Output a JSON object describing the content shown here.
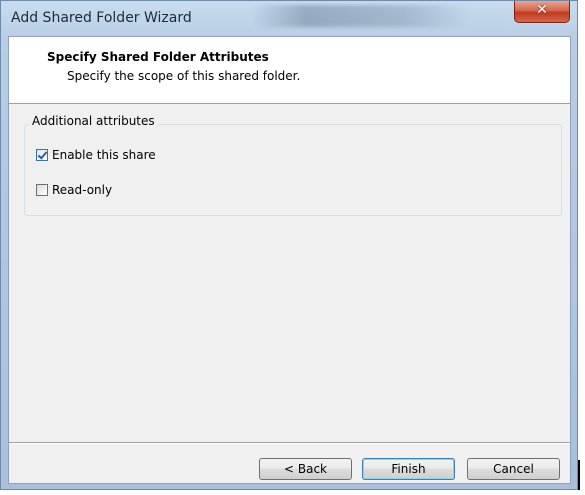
{
  "window": {
    "title": "Add Shared Folder Wizard",
    "close_glyph": "✕"
  },
  "header": {
    "title": "Specify Shared Folder Attributes",
    "subtitle": "Specify the scope of this shared folder."
  },
  "attributes": {
    "group_label": "Additional attributes",
    "options": [
      {
        "label": "Enable this share",
        "checked": true
      },
      {
        "label": "Read-only",
        "checked": false
      }
    ]
  },
  "buttons": {
    "back": "< Back",
    "finish": "Finish",
    "cancel": "Cancel"
  }
}
